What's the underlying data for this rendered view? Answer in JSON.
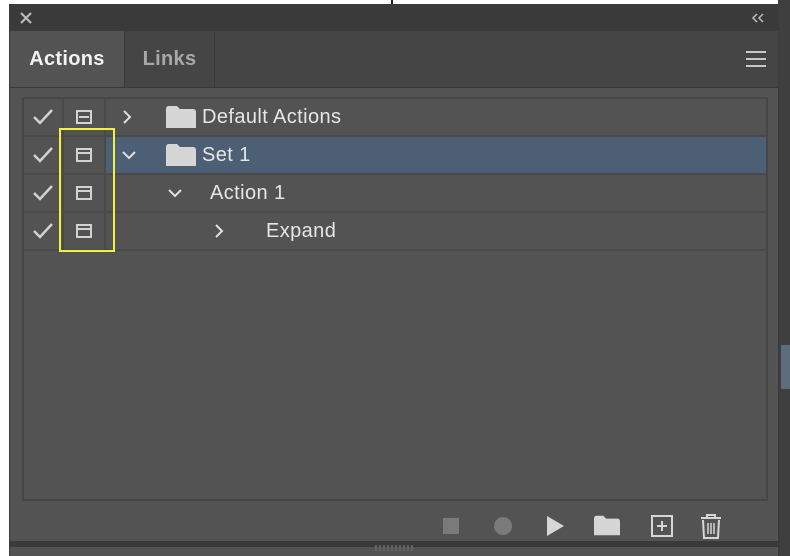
{
  "panel": {
    "tabs": [
      {
        "label": "Actions",
        "active": true
      },
      {
        "label": "Links",
        "active": false
      }
    ]
  },
  "actions_list": {
    "rows": [
      {
        "label": "Default Actions",
        "level": 0,
        "expanded": false,
        "checked": true,
        "dialog_icon": "dialog-toggle-partial-icon",
        "selected": false
      },
      {
        "label": "Set 1",
        "level": 0,
        "expanded": true,
        "checked": true,
        "dialog_icon": "dialog-toggle-icon",
        "selected": true
      },
      {
        "label": "Action 1",
        "level": 1,
        "expanded": true,
        "checked": true,
        "dialog_icon": "dialog-toggle-icon",
        "selected": false
      },
      {
        "label": "Expand",
        "level": 2,
        "expanded": false,
        "checked": true,
        "dialog_icon": "dialog-toggle-icon",
        "selected": false
      }
    ]
  },
  "footer": {
    "buttons": [
      "stop-icon",
      "record-icon",
      "play-icon",
      "new-set-folder-icon",
      "new-action-icon",
      "delete-trash-icon"
    ]
  },
  "colors": {
    "panel_bg": "#535353",
    "selected_row": "#4d5f74",
    "highlight_box": "#f2f23a"
  }
}
